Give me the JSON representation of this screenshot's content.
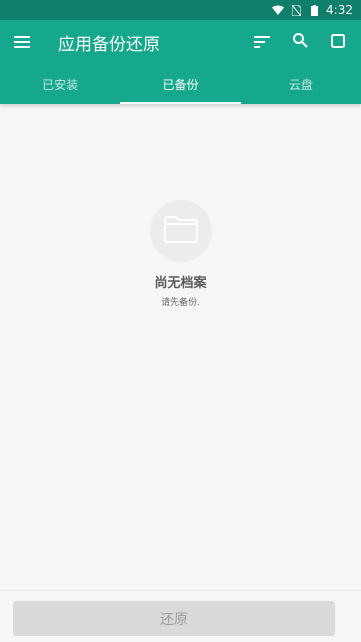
{
  "status_bar": {
    "time": "4:32",
    "icons": [
      "wifi-icon",
      "no-sim-icon",
      "battery-icon"
    ]
  },
  "app_bar": {
    "title": "应用备份还原",
    "actions": [
      "sort-icon",
      "search-icon",
      "select-all-icon"
    ]
  },
  "tabs": [
    {
      "label": "已安装",
      "active": false
    },
    {
      "label": "已备份",
      "active": true
    },
    {
      "label": "云盘",
      "active": false
    }
  ],
  "empty_state": {
    "icon": "folder-icon",
    "title": "尚无档案",
    "subtitle": "请先备份."
  },
  "bottom": {
    "restore_label": "还原"
  },
  "colors": {
    "status_bar": "#0f7f6b",
    "primary": "#16a88c",
    "background": "#f6f6f6",
    "button_disabled": "#dadada"
  }
}
